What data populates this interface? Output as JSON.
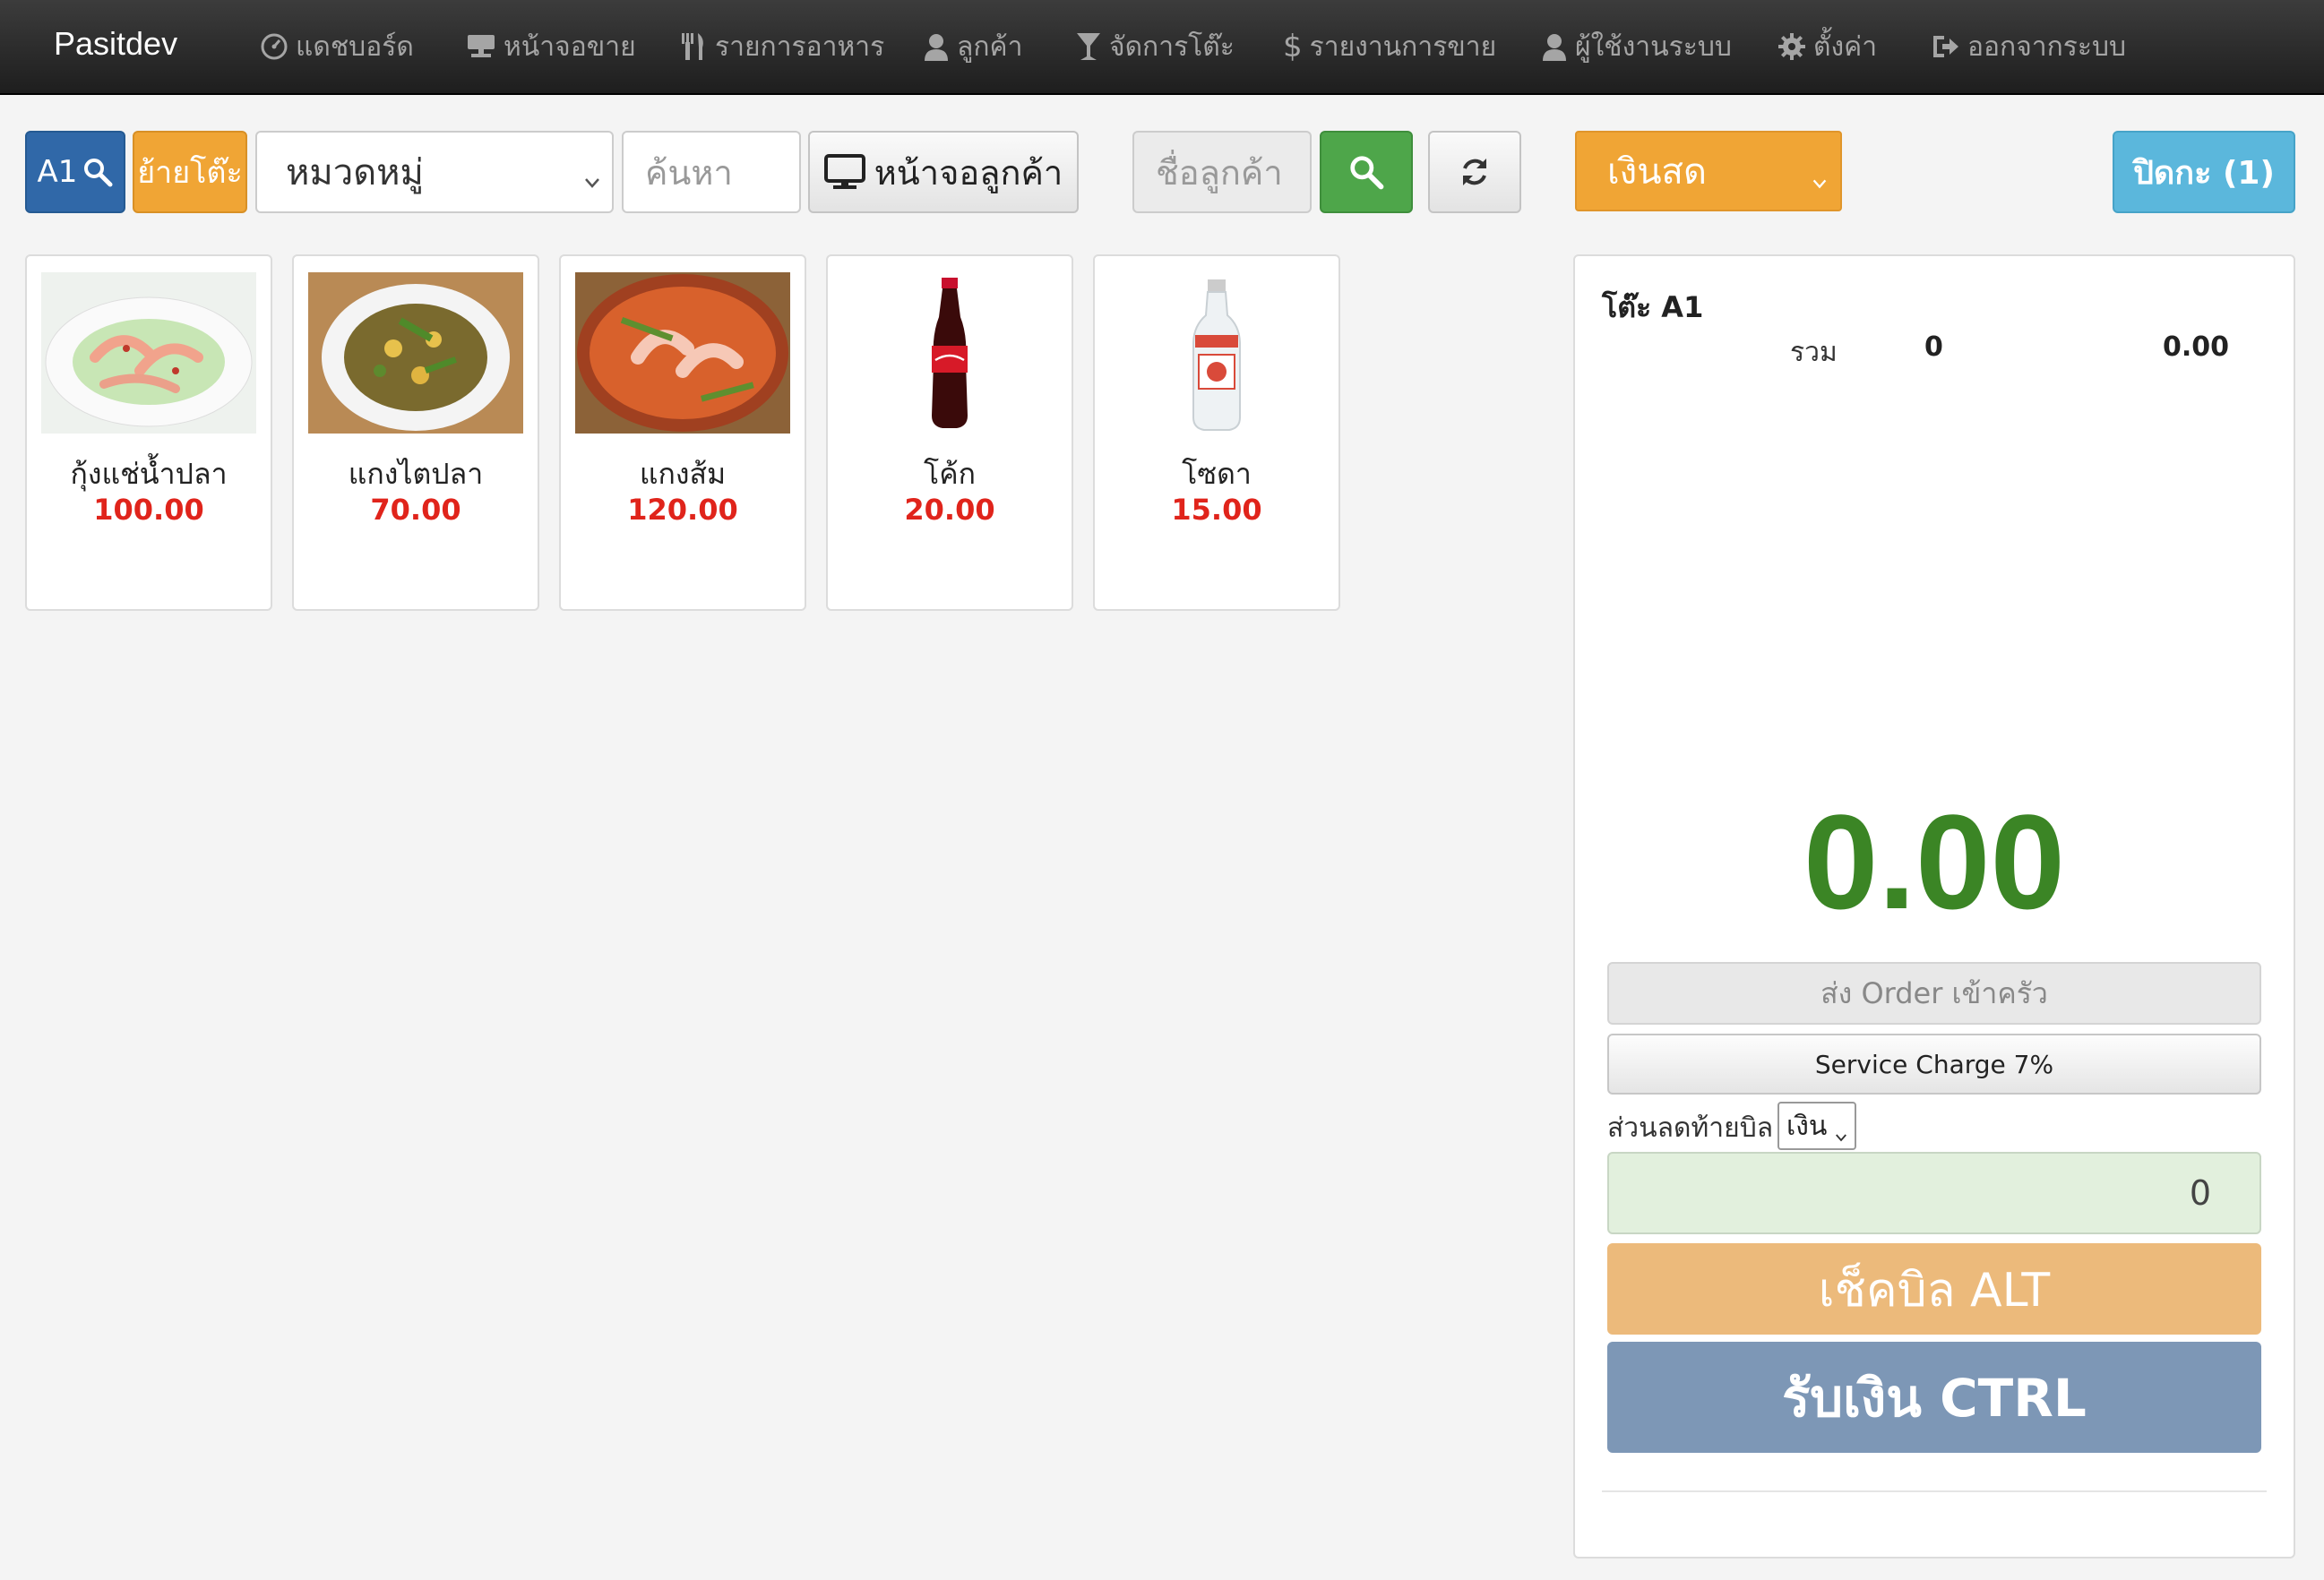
{
  "navbar": {
    "brand": "Pasitdev",
    "items": [
      {
        "label": "แดชบอร์ด",
        "icon": "dashboard-icon"
      },
      {
        "label": "หน้าจอขาย",
        "icon": "pos-screen-icon"
      },
      {
        "label": "รายการอาหาร",
        "icon": "cutlery-icon"
      },
      {
        "label": "ลูกค้า",
        "icon": "user-icon"
      },
      {
        "label": "จัดการโต๊ะ",
        "icon": "glass-icon"
      },
      {
        "label": "รายงานการขาย",
        "icon": "dollar-icon"
      },
      {
        "label": "ผู้ใช้งานระบบ",
        "icon": "user-icon"
      },
      {
        "label": "ตั้งค่า",
        "icon": "gear-icon"
      },
      {
        "label": "ออกจากระบบ",
        "icon": "logout-icon"
      }
    ]
  },
  "toolbar": {
    "table_button_label": "A1",
    "move_table_label": "ย้ายโต๊ะ",
    "category_selected": "หมวดหมู่",
    "search_placeholder": "ค้นหา",
    "customer_screen_label": "หน้าจอลูกค้า",
    "customer_name_placeholder": "ชื่อลูกค้า",
    "payment_method_selected": "เงินสด",
    "close_shift_label": "ปิดกะ (1)"
  },
  "products": [
    {
      "name": "กุ้งแช่น้ำปลา",
      "price": "100.00",
      "image": "shrimp-dish"
    },
    {
      "name": "แกงไตปลา",
      "price": "70.00",
      "image": "curry-dish"
    },
    {
      "name": "แกงส้ม",
      "price": "120.00",
      "image": "sour-soup-dish"
    },
    {
      "name": "โค้ก",
      "price": "20.00",
      "image": "coke-bottle"
    },
    {
      "name": "โซดา",
      "price": "15.00",
      "image": "soda-bottle"
    }
  ],
  "order": {
    "table_title": "โต๊ะ A1",
    "sum_label": "รวม",
    "sum_qty": "0",
    "sum_amount": "0.00",
    "grand_total": "0.00",
    "send_kitchen_label": "ส่ง Order เข้าครัว",
    "service_charge_label": "Service Charge 7%",
    "discount_label": "ส่วนลดท้ายบิล",
    "discount_type_selected": "เงิน",
    "discount_value": "0",
    "check_bill_label": "เช็คบิล ALT",
    "receive_payment_label": "รับเงิน CTRL"
  },
  "colors": {
    "navbar_bg": "#2b2b2b",
    "primary": "#3068a8",
    "warning": "#f0a535",
    "success": "#4ea64a",
    "info": "#5bb7dc",
    "price_red": "#e0241b",
    "total_green": "#3b8525",
    "check_bill": "#ecba7b",
    "pay_button": "#7d97b6"
  }
}
